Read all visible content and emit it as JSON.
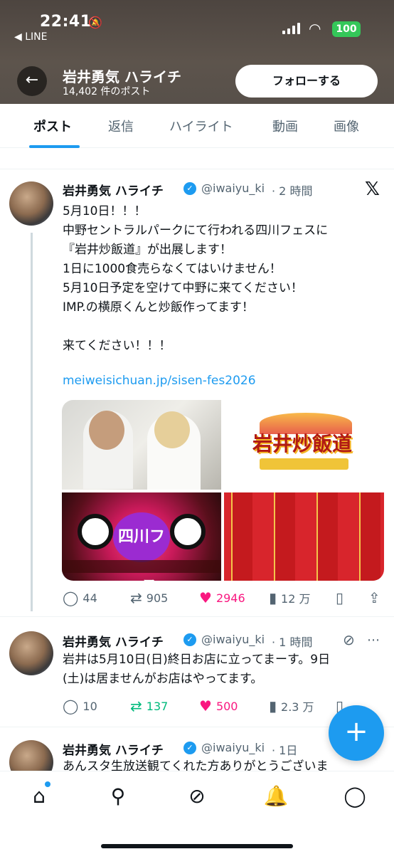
{
  "status_bar": {
    "time": "22:41",
    "back_app": "◀ LINE",
    "battery": "100"
  },
  "header": {
    "back_icon": "←",
    "profile_name": "岩井勇気 ハライチ",
    "post_count": "14,402 件のポスト",
    "follow_label": "フォローする"
  },
  "tabs": [
    {
      "label": "ポスト"
    },
    {
      "label": "返信"
    },
    {
      "label": "ハイライト"
    },
    {
      "label": "動画"
    },
    {
      "label": "画像"
    }
  ],
  "tweets": [
    {
      "name": "岩井勇気 ハライチ",
      "handle": "@iwaiyu_ki",
      "time": "· 2 時間",
      "text": "5月10日！！！\n中野セントラルパークにて行われる四川フェスに\n『岩井炒飯道』が出展します！\n1日に1000食売らなくてはいけません！\n5月10日予定を空けて中野に来てください！\nIMP.の横原くんと炒飯作ってます！\n\n来てください！！！",
      "link": "meiweisichuan.jp/sisen-fes2026",
      "media_logo": "岩井炒飯道",
      "media_fest": "四川フェス",
      "replies": "44",
      "retweets": "905",
      "likes": "2946",
      "views": "12 万"
    },
    {
      "name": "岩井勇気 ハライチ",
      "handle": "@iwaiyu_ki",
      "time": "· 1 時間",
      "text": "岩井は5月10日(日)終日お店に立ってまーす。9日\n(土)は居ませんがお店はやってます。",
      "replies": "10",
      "retweets": "137",
      "likes": "500",
      "views": "2.3 万"
    },
    {
      "name": "岩井勇気 ハライチ",
      "handle": "@iwaiyu_ki",
      "time": "· 1日",
      "text": "あんスタ生放送観てくれた方ありがとうございま"
    }
  ],
  "icons": {
    "x_logo": "𝕏",
    "reply": "◯",
    "retweet": "⇄",
    "like": "♥",
    "views": "▮",
    "bookmark": "▯",
    "share": "⇪",
    "grok": "⊘",
    "more": "⋯",
    "fab": "+",
    "home": "⌂",
    "search": "⚲",
    "bell": "🔔",
    "mail": "◯"
  },
  "colors": {
    "accent": "#1d9bf0",
    "like": "#f91880",
    "retweet_active": "#00ba7c"
  }
}
